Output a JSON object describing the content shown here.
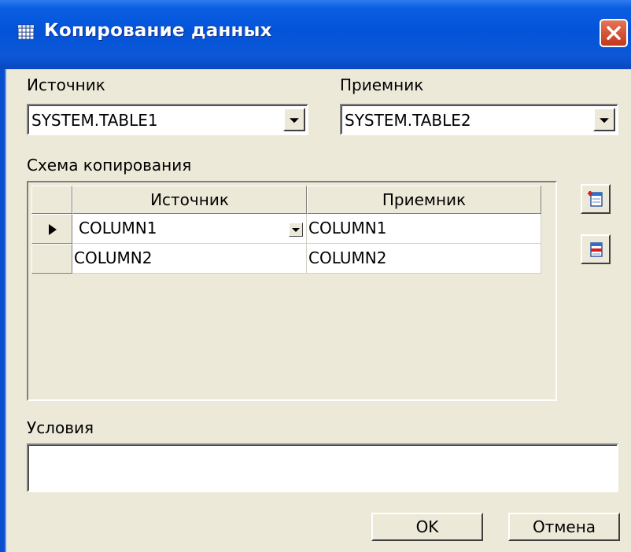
{
  "window": {
    "title": "Копирование данных",
    "icon": "table-icon",
    "close_icon": "close-icon"
  },
  "source": {
    "label": "Источник",
    "value": "SYSTEM.TABLE1"
  },
  "target": {
    "label": "Приемник",
    "value": "SYSTEM.TABLE2"
  },
  "mapping": {
    "label": "Схема копирования",
    "columns": [
      "Источник",
      "Приемник"
    ],
    "rows": [
      {
        "source": "COLUMN1",
        "target": "COLUMN1",
        "current": true
      },
      {
        "source": "COLUMN2",
        "target": "COLUMN2",
        "current": false
      }
    ],
    "add_icon": "add-row-icon",
    "remove_icon": "remove-row-icon"
  },
  "conditions": {
    "label": "Условия",
    "value": ""
  },
  "buttons": {
    "ok": "OK",
    "cancel": "Отмена"
  },
  "colors": {
    "titlebar": "#0353d8",
    "dialog_bg": "#ece9d8",
    "close_button": "#c2381e"
  }
}
